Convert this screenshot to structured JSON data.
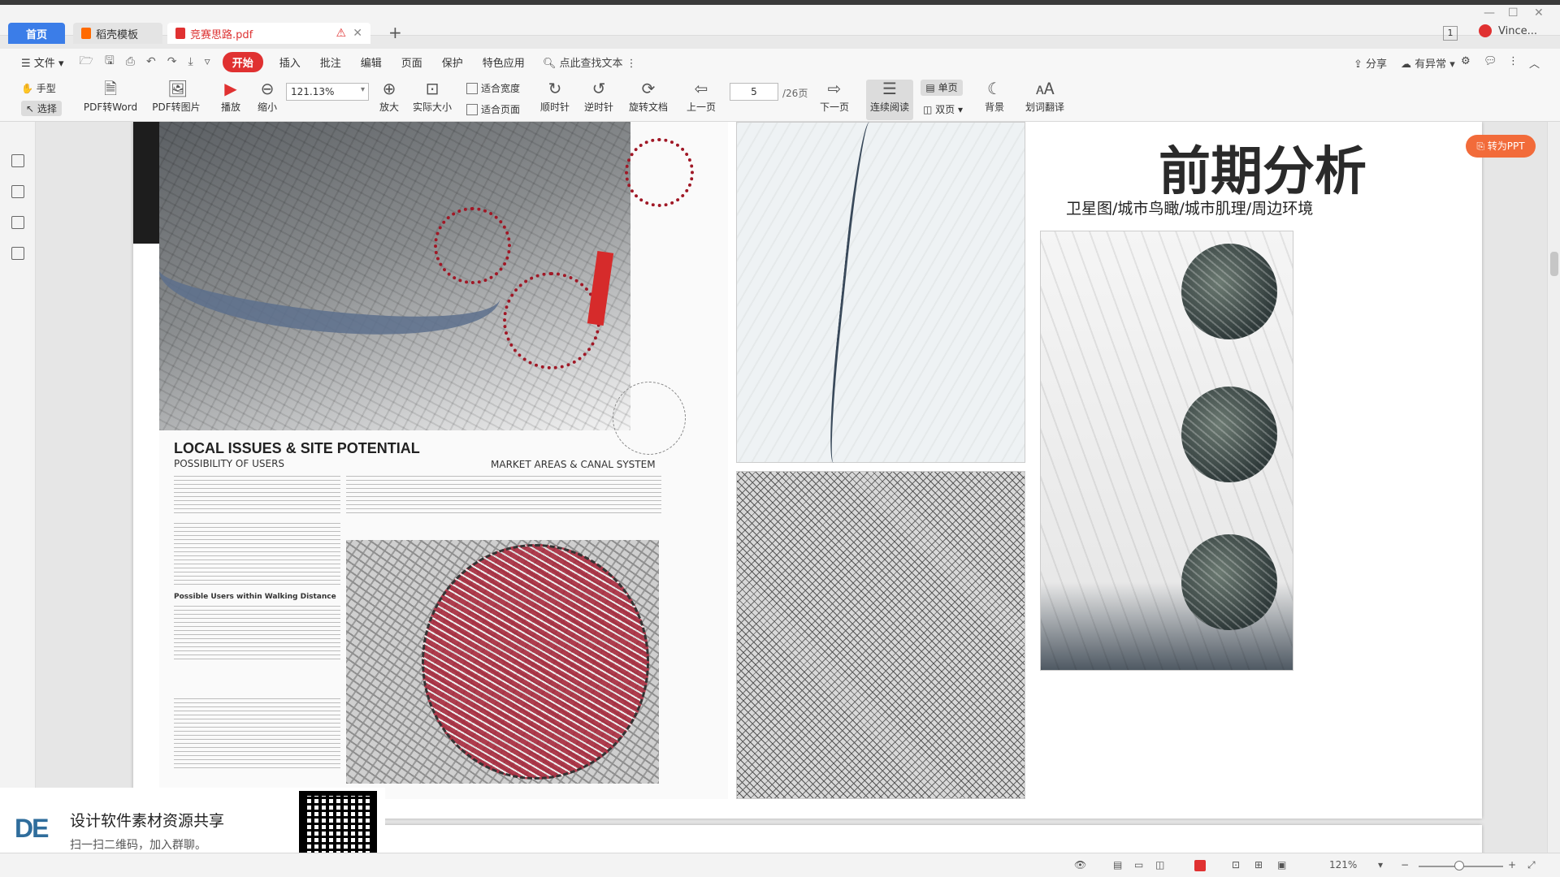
{
  "tabs": [
    {
      "label": "首页"
    },
    {
      "label": "稻壳模板"
    },
    {
      "label": "竞赛思路.pdf"
    }
  ],
  "titlebar": {
    "page_badge": "1",
    "user": "Vince..."
  },
  "menu": {
    "file": "文件",
    "items": [
      "开始",
      "插入",
      "批注",
      "编辑",
      "页面",
      "保护",
      "特色应用"
    ],
    "search": "点此查找文本",
    "share": "分享",
    "issue": "有异常"
  },
  "toolbar": {
    "hand": "手型",
    "select": "选择",
    "pdf_to_word": "PDF转Word",
    "pdf_to_image": "PDF转图片",
    "play": "播放",
    "zoom_out": "缩小",
    "zoom_value": "121.13%",
    "zoom_in": "放大",
    "actual_size": "实际大小",
    "fit_width": "适合宽度",
    "fit_page": "适合页面",
    "clockwise": "顺时针",
    "counterclockwise": "逆时针",
    "rotate_doc": "旋转文档",
    "prev_page": "上一页",
    "page_current": "5",
    "page_total": "/26页",
    "next_page": "下一页",
    "continuous": "连续阅读",
    "single": "单页",
    "double": "双页",
    "background": "背景",
    "translate": "划词翻译"
  },
  "document": {
    "local_issues": "LOCAL ISSUES & SITE POTENTIAL",
    "possibility": "POSSIBILITY OF USERS",
    "market": "MARKET AREAS & CANAL SYSTEM",
    "walking": "Possible Users within Walking Distance",
    "title_cn": "前期分析",
    "subtitle_cn": "卫星图/城市鸟瞰/城市肌理/周边环境"
  },
  "float": {
    "to_ppt": "转为PPT"
  },
  "watermark": {
    "logo": "DE",
    "title": "设计软件素材资源共享",
    "subtitle": "扫一扫二维码，加入群聊。"
  },
  "status": {
    "zoom": "121%"
  },
  "colors": {
    "accent": "#3b7de8",
    "start_red": "#e03131",
    "ppt_orange": "#f26b3a"
  }
}
